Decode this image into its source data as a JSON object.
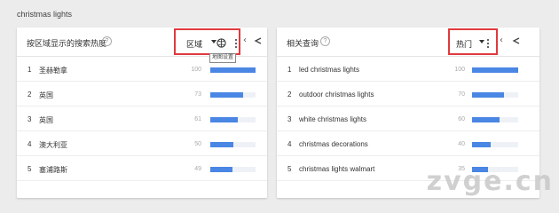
{
  "page": {
    "title": "christmas lights"
  },
  "regional": {
    "title": "按区域显示的搜索热度",
    "dropdown_label": "区域",
    "tooltip": "地图设置",
    "rows": [
      {
        "rank": "1",
        "name": "圣赫勒拿",
        "value": "100",
        "fraction": 1.0
      },
      {
        "rank": "2",
        "name": "英国",
        "value": "73",
        "fraction": 0.73
      },
      {
        "rank": "3",
        "name": "英国",
        "value": "61",
        "fraction": 0.61
      },
      {
        "rank": "4",
        "name": "澳大利亚",
        "value": "50",
        "fraction": 0.5
      },
      {
        "rank": "5",
        "name": "塞浦路斯",
        "value": "49",
        "fraction": 0.49
      }
    ]
  },
  "related": {
    "title": "相关查询",
    "dropdown_label": "热门",
    "rows": [
      {
        "rank": "1",
        "name": "led christmas lights",
        "value": "100",
        "fraction": 1.0
      },
      {
        "rank": "2",
        "name": "outdoor christmas lights",
        "value": "70",
        "fraction": 0.7
      },
      {
        "rank": "3",
        "name": "white christmas lights",
        "value": "60",
        "fraction": 0.6
      },
      {
        "rank": "4",
        "name": "christmas decorations",
        "value": "40",
        "fraction": 0.4
      },
      {
        "rank": "5",
        "name": "christmas lights walmart",
        "value": "35",
        "fraction": 0.35
      }
    ]
  },
  "watermark": "zvge.cn",
  "colors": {
    "bar": "#4a86e4",
    "highlight": "#e03a3e"
  },
  "icons": [
    "help-icon",
    "globe-icon",
    "more-vert-icon",
    "share-icon",
    "chevron-left-icon"
  ]
}
